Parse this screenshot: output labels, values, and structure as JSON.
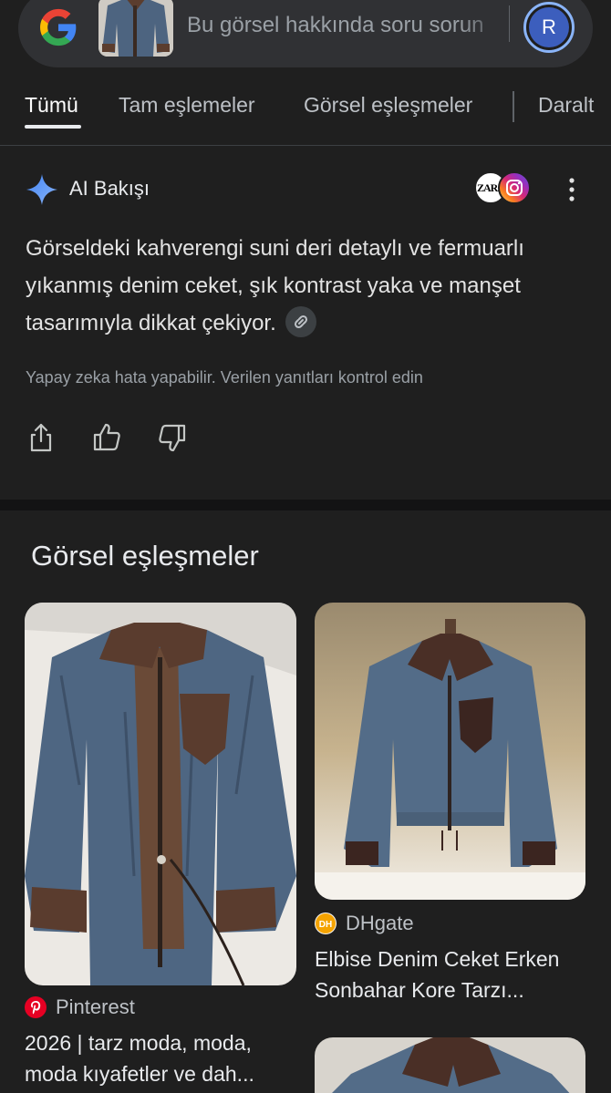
{
  "search": {
    "placeholder": "Bu görsel hakkında soru sorun",
    "avatar_letter": "R",
    "icons": {
      "logo": "google-g-icon",
      "thumbnail": "query-image-thumbnail"
    }
  },
  "tabs": [
    {
      "label": "Tümü",
      "active": true
    },
    {
      "label": "Tam eşlemeler",
      "active": false
    },
    {
      "label": "Görsel eşleşmeler",
      "active": false
    },
    {
      "label": "Daralt",
      "active": false
    }
  ],
  "ai_overview": {
    "title": "AI Bakışı",
    "source_icons": [
      "zara-icon",
      "instagram-icon"
    ],
    "zara_logo_text": "ZARA",
    "text": "Görseldeki kahverengi suni deri detaylı ve fermuarlı yıkanmış denim ceket, şık kontrast yaka ve manşet tasarımıyla dikkat çekiyor.",
    "disclaimer": "Yapay zeka hata yapabilir. Verilen yanıtları kontrol edin",
    "actions": [
      "share-icon",
      "thumbs-up-icon",
      "thumbs-down-icon"
    ]
  },
  "visual_matches": {
    "title": "Görsel eşleşmeler",
    "results": [
      {
        "source": "Pinterest",
        "title_line1": "2026 | tarz moda, moda,",
        "title_line2": "moda kıyafetler ve dah..."
      },
      {
        "source": "DHgate",
        "title_line1": "Elbise Denim Ceket Erken",
        "title_line2": "Sonbahar Kore Tarzı..."
      }
    ]
  },
  "colors": {
    "background": "#1f1f1f",
    "search_box": "#303134",
    "accent_blue": "#8ab4f8",
    "pinterest_red": "#e60023"
  }
}
